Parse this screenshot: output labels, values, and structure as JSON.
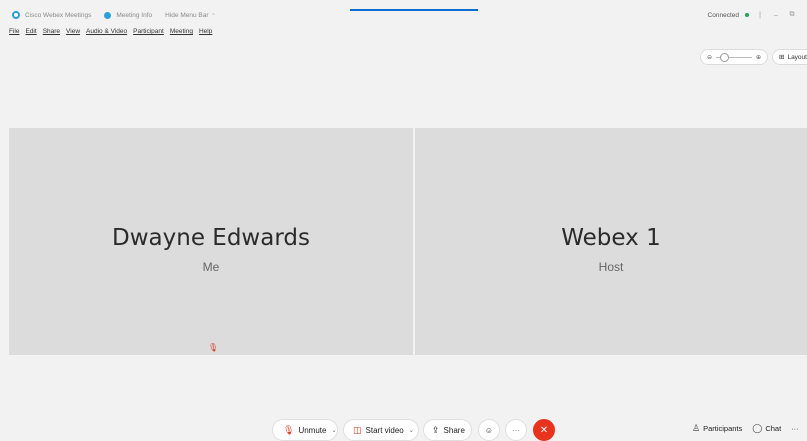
{
  "titlebar": {
    "app_name": "Cisco Webex Meetings",
    "meeting_info": "Meeting Info",
    "hide_menu_bar": "Hide Menu Bar",
    "connection_status": "Connected",
    "minimize": "–",
    "restore": "⧉",
    "status_color": "#21a453"
  },
  "menu": {
    "items": [
      "File",
      "Edit",
      "Share",
      "View",
      "Audio & Video",
      "Participant",
      "Meeting",
      "Help"
    ]
  },
  "view_controls": {
    "zoom_out": "⊖",
    "zoom_in": "⊕",
    "layout_label": "Layout"
  },
  "participants": [
    {
      "name": "Dwayne Edwards",
      "role": "Me"
    },
    {
      "name": "Webex 1",
      "role": "Host"
    }
  ],
  "controls": {
    "unmute_label": "Unmute",
    "start_video_label": "Start video",
    "share_label": "Share",
    "more_label": "···",
    "end_label": "✕",
    "participants_label": "Participants",
    "chat_label": "Chat",
    "overflow_label": "···"
  },
  "icons": {
    "mic_muted": "🎙",
    "video_off": "◫",
    "share": "⇪",
    "emoji": "☺",
    "participants": "♙",
    "chat": "◯",
    "layout": "⊞"
  },
  "colors": {
    "accent": "#2a9fd8",
    "end_call": "#e8341c",
    "muted_red": "#d9381e"
  }
}
